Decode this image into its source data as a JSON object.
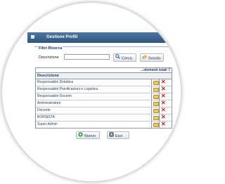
{
  "window": {
    "title": "Gestione Profili"
  },
  "filters": {
    "legend": "Filtri Ricerca",
    "description_label": "Descrizione",
    "description_value": "",
    "search_button": "Cerca",
    "clear_button": "Svuota"
  },
  "grid": {
    "total_label": "...elementi totali 7",
    "header_description": "Descrizione",
    "rows": [
      {
        "description": "Responsabile Didattica"
      },
      {
        "description": "Responsabile Pianificazioni e Logistica"
      },
      {
        "description": "Responsabile Docenti"
      },
      {
        "description": "Amministratore"
      },
      {
        "description": "Docente"
      },
      {
        "description": "BORSISTA"
      },
      {
        "description": "Super Admin"
      }
    ]
  },
  "actions": {
    "new_button": "Nuovo",
    "exit_button": "Esci"
  },
  "colors": {
    "titlebar": "#2d5580",
    "accent": "#1d3a63",
    "delete": "#d31c1c",
    "edit": "#e9c46a"
  }
}
